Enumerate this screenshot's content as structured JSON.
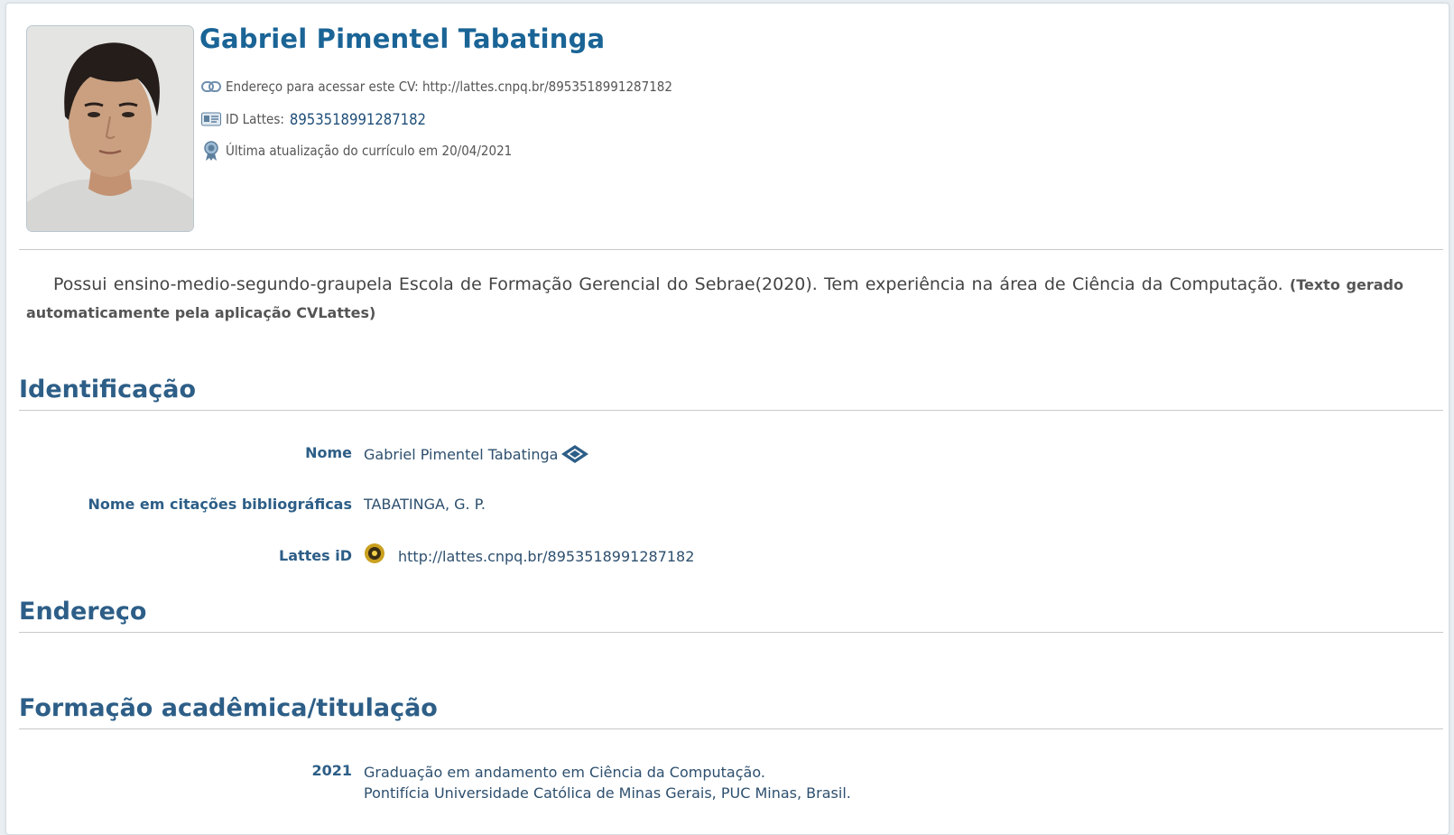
{
  "header": {
    "name": "Gabriel Pimentel Tabatinga",
    "cv_address_label": "Endereço para acessar este CV: http://lattes.cnpq.br/8953518991287182",
    "id_label": "ID Lattes:",
    "id_value": "8953518991287182",
    "last_update": "Última atualização do currículo em 20/04/2021"
  },
  "summary": {
    "text": "Possui ensino-medio-segundo-graupela Escola de Formação Gerencial do Sebrae(2020). Tem experiência na área de Ciência da Computação.",
    "auto_note": "(Texto gerado automaticamente pela aplicação CVLattes)"
  },
  "identificacao": {
    "title": "Identificação",
    "nome_label": "Nome",
    "nome_value": "Gabriel Pimentel Tabatinga",
    "citacoes_label": "Nome em citações bibliográficas",
    "citacoes_value": "TABATINGA, G. P.",
    "lattes_label": "Lattes iD",
    "lattes_value": "http://lattes.cnpq.br/8953518991287182"
  },
  "endereco": {
    "title": "Endereço"
  },
  "formacao": {
    "title": "Formação acadêmica/titulação",
    "items": [
      {
        "year": "2021",
        "line1": "Graduação em andamento em Ciência da Computação.",
        "line2": "Pontifícia Universidade Católica de Minas Gerais, PUC Minas, Brasil."
      }
    ]
  },
  "colors": {
    "accent": "#1a6496",
    "section": "#2d5e87"
  },
  "icons": [
    "link-icon",
    "id-card-icon",
    "award-icon",
    "receita-federal-icon",
    "lattes-id-icon",
    "profile-photo"
  ]
}
